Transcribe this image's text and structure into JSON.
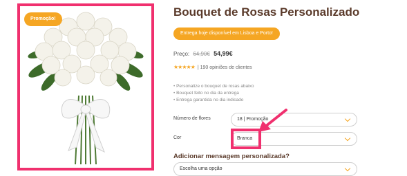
{
  "product": {
    "promo_badge": "Promoção!",
    "title": "Bouquet de Rosas Personalizado",
    "delivery_pill": "Entrega hoje disponível em Lisboa e Porto!",
    "price_label": "Preço:",
    "old_price": "64,90€",
    "new_price": "54,99€",
    "rating_stars": "★★★★★",
    "rating_text": "| 190 opiniões de clientes",
    "bullets": [
      "Personalize o bouquet de rosas abaixo",
      "Bouquet feito no dia da entrega",
      "Entrega garantida no dia indicado"
    ]
  },
  "options": {
    "flowers_label": "Número de flores",
    "flowers_value": "18 | Promoção",
    "color_label": "Cor",
    "color_value": "Branca",
    "message_label": "Adicionar mensagem personalizada?",
    "message_value": "Escolha uma opção"
  },
  "colors": {
    "accent_orange": "#f5a623",
    "highlight_pink": "#f0306e",
    "title_brown": "#5a3a2a"
  }
}
